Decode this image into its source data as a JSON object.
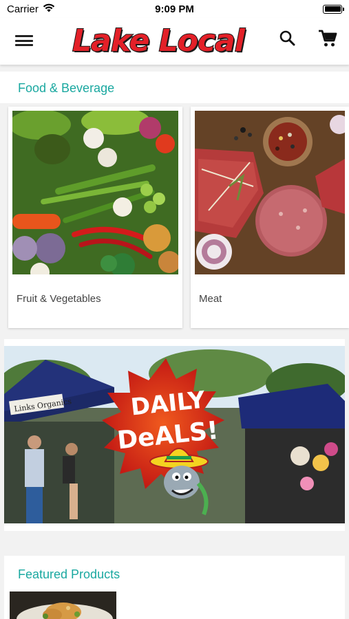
{
  "status_bar": {
    "carrier": "Carrier",
    "time": "9:09 PM"
  },
  "header": {
    "logo_text": "Lake Local"
  },
  "sections": {
    "food_title": "Food & Beverage",
    "featured_title": "Featured Products"
  },
  "categories": [
    {
      "label": "Fruit & Vegetables"
    },
    {
      "label": "Meat"
    }
  ],
  "banner": {
    "text_line1": "DAILY",
    "text_line2": "DeALS!",
    "sign_text": "Links Organics"
  },
  "colors": {
    "accent": "#1aa8a0",
    "logo_red": "#e32028",
    "deal_red": "#d42a1c"
  }
}
